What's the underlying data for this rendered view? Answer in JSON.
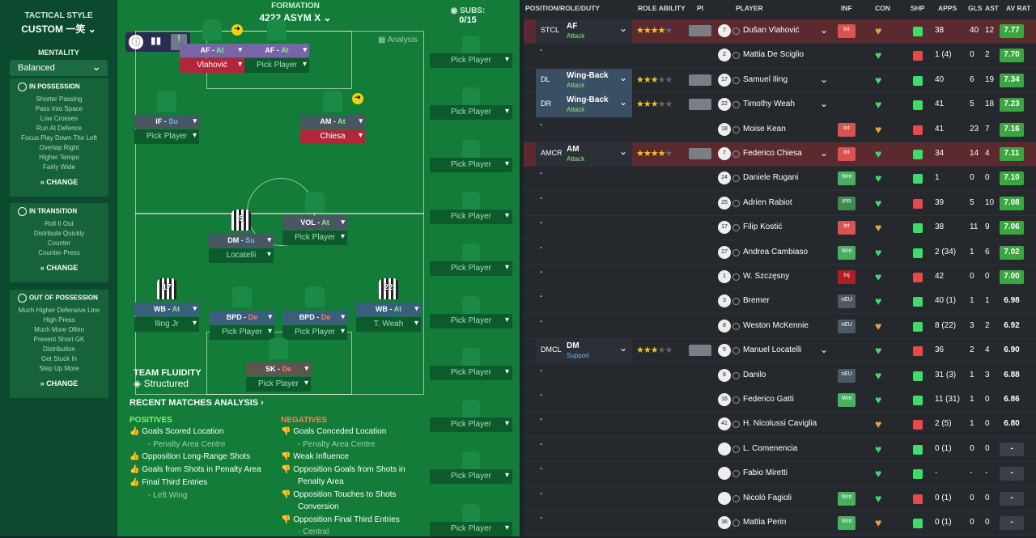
{
  "sidebar": {
    "tactical_style_label": "TACTICAL STYLE",
    "tactical_style": "CUSTOM 一笑",
    "mentality_label": "MENTALITY",
    "mentality": "Balanced",
    "in_possession": {
      "title": "IN POSSESSION",
      "items": [
        "Shorter Passing",
        "Pass Into Space",
        "Low Crosses",
        "Run At Defence",
        "Focus Play Down The Left",
        "Overlap Right",
        "Higher Tempo",
        "Fairly Wide"
      ],
      "change": "CHANGE"
    },
    "in_transition": {
      "title": "IN TRANSITION",
      "items": [
        "Roll It Out",
        "Distribute Quickly",
        "Counter",
        "Counter-Press"
      ],
      "change": "CHANGE"
    },
    "out_of_possession": {
      "title": "OUT OF POSSESSION",
      "items": [
        "Much Higher Defensive Line",
        "High Press",
        "Much More Often",
        "Prevent Short GK",
        "Distribution",
        "Get Stuck In",
        "Step Up More"
      ],
      "change": "CHANGE"
    }
  },
  "pitch": {
    "formation_label": "FORMATION",
    "formation": "4222 ASYM X",
    "analysis": "Analysis",
    "subs_label": "SUBS:",
    "subs_count": "0/15",
    "pick": "Pick Player",
    "team_fluidity_label": "TEAM FLUIDITY",
    "team_fluidity": "Structured",
    "positions": [
      {
        "role": "AF",
        "duty": "At",
        "player": "Vlahović",
        "num": ""
      },
      {
        "role": "AF",
        "duty": "At",
        "player": "Pick Player",
        "num": ""
      },
      {
        "role": "IF",
        "duty": "Su",
        "player": "Pick Player",
        "num": ""
      },
      {
        "role": "AM",
        "duty": "At",
        "player": "Chiesa",
        "num": ""
      },
      {
        "role": "VOL",
        "duty": "At",
        "player": "Pick Player",
        "num": ""
      },
      {
        "role": "DM",
        "duty": "Su",
        "player": "Locatelli",
        "num": "5"
      },
      {
        "role": "WB",
        "duty": "At",
        "player": "Iling Jr",
        "num": "17"
      },
      {
        "role": "BPD",
        "duty": "De",
        "player": "Pick Player",
        "num": ""
      },
      {
        "role": "BPD",
        "duty": "De",
        "player": "Pick Player",
        "num": ""
      },
      {
        "role": "WB",
        "duty": "At",
        "player": "T. Weah",
        "num": "22"
      },
      {
        "role": "SK",
        "duty": "De",
        "player": "Pick Player",
        "num": ""
      }
    ]
  },
  "analysis": {
    "title": "RECENT MATCHES ANALYSIS",
    "positives_label": "POSITIVES",
    "positives": [
      "Goals Scored Location",
      "- Penalty Area Centre",
      "Opposition Long-Range Shots",
      "Goals from Shots in Penalty Area",
      "Final Third Entries",
      "- Left Wing"
    ],
    "negatives_label": "NEGATIVES",
    "negatives": [
      "Goals Conceded Location",
      "- Penalty Area Centre",
      "Weak Influence",
      "Opposition Goals from Shots in",
      "Penalty Area",
      "Opposition Touches to Shots",
      "Conversion",
      "Opposition Final Third Entries",
      "- Central"
    ]
  },
  "table": {
    "headers": [
      "POSITION/ROLE/DUTY",
      "ROLE ABILITY",
      "PI",
      "PLAYER",
      "INF",
      "CON",
      "SHP",
      "APPS",
      "GLS",
      "AST",
      "AV RAT"
    ],
    "rows": [
      {
        "pos": "STCL",
        "role": "AF",
        "duty": "Attack",
        "stars": "★★★★",
        "estars": "★",
        "num": "7",
        "name": "Dušan Vlahović",
        "inf": "Int",
        "apps": "38",
        "gls": "40",
        "ast": "12",
        "rat": "7.77"
      },
      {
        "pos": "",
        "role": "",
        "duty": "",
        "stars": "",
        "estars": "",
        "num": "2",
        "name": "Mattia De Sciglio",
        "inf": "",
        "apps": "1 (4)",
        "gls": "0",
        "ast": "2",
        "rat": "7.70"
      },
      {
        "pos": "DL",
        "role": "Wing-Back",
        "duty": "Attack",
        "stars": "★★★",
        "estars": "★★",
        "num": "17",
        "name": "Samuel Iling",
        "inf": "",
        "apps": "40",
        "gls": "6",
        "ast": "19",
        "rat": "7.34"
      },
      {
        "pos": "DR",
        "role": "Wing-Back",
        "duty": "Attack",
        "stars": "★★★",
        "estars": "★★",
        "num": "22",
        "name": "Timothy Weah",
        "inf": "",
        "apps": "41",
        "gls": "5",
        "ast": "18",
        "rat": "7.23"
      },
      {
        "pos": "",
        "role": "",
        "duty": "",
        "stars": "",
        "estars": "",
        "num": "18",
        "name": "Moise Kean",
        "inf": "Int",
        "apps": "41",
        "gls": "23",
        "ast": "7",
        "rat": "7.16"
      },
      {
        "pos": "AMCR",
        "role": "AM",
        "duty": "Attack",
        "stars": "★★★★",
        "estars": "★",
        "num": "7",
        "name": "Federico Chiesa",
        "inf": "Int",
        "apps": "34",
        "gls": "14",
        "ast": "4",
        "rat": "7.11"
      },
      {
        "pos": "",
        "role": "",
        "duty": "",
        "stars": "",
        "estars": "",
        "num": "24",
        "name": "Daniele Rugani",
        "inf": "Wnt",
        "apps": "1",
        "gls": "0",
        "ast": "0",
        "rat": "7.10"
      },
      {
        "pos": "",
        "role": "",
        "duty": "",
        "stars": "",
        "estars": "",
        "num": "25",
        "name": "Adrien Rabiot",
        "inf": "IPR",
        "apps": "39",
        "gls": "5",
        "ast": "10",
        "rat": "7.08"
      },
      {
        "pos": "",
        "role": "",
        "duty": "",
        "stars": "",
        "estars": "",
        "num": "17",
        "name": "Filip Kostić",
        "inf": "Int",
        "apps": "38",
        "gls": "11",
        "ast": "9",
        "rat": "7.06"
      },
      {
        "pos": "",
        "role": "",
        "duty": "",
        "stars": "",
        "estars": "",
        "num": "27",
        "name": "Andrea Cambiaso",
        "inf": "Wnt",
        "apps": "2 (34)",
        "gls": "1",
        "ast": "6",
        "rat": "7.02"
      },
      {
        "pos": "",
        "role": "",
        "duty": "",
        "stars": "",
        "estars": "",
        "num": "1",
        "name": "W. Szczęsny",
        "inf": "Inj",
        "apps": "42",
        "gls": "0",
        "ast": "0",
        "rat": "7.00"
      },
      {
        "pos": "",
        "role": "",
        "duty": "",
        "stars": "",
        "estars": "",
        "num": "3",
        "name": "Bremer",
        "inf": "nEU",
        "apps": "40 (1)",
        "gls": "1",
        "ast": "1",
        "rat": "6.98"
      },
      {
        "pos": "",
        "role": "",
        "duty": "",
        "stars": "",
        "estars": "",
        "num": "8",
        "name": "Weston McKennie",
        "inf": "nEU",
        "apps": "8 (22)",
        "gls": "3",
        "ast": "2",
        "rat": "6.92"
      },
      {
        "pos": "DMCL",
        "role": "DM",
        "duty": "Support",
        "stars": "★★★",
        "estars": "★★",
        "num": "5",
        "name": "Manuel Locatelli",
        "inf": "",
        "apps": "36",
        "gls": "2",
        "ast": "4",
        "rat": "6.90"
      },
      {
        "pos": "",
        "role": "",
        "duty": "",
        "stars": "",
        "estars": "",
        "num": "6",
        "name": "Danilo",
        "inf": "nEU",
        "apps": "31 (3)",
        "gls": "1",
        "ast": "3",
        "rat": "6.88"
      },
      {
        "pos": "",
        "role": "",
        "duty": "",
        "stars": "",
        "estars": "",
        "num": "16",
        "name": "Federico Gatti",
        "inf": "Wnt",
        "apps": "11 (31)",
        "gls": "1",
        "ast": "0",
        "rat": "6.86"
      },
      {
        "pos": "",
        "role": "",
        "duty": "",
        "stars": "",
        "estars": "",
        "num": "41",
        "name": "H. Nicolussi Caviglia",
        "inf": "",
        "apps": "2 (5)",
        "gls": "1",
        "ast": "0",
        "rat": "6.80"
      },
      {
        "pos": "",
        "role": "",
        "duty": "",
        "stars": "",
        "estars": "",
        "num": "",
        "name": "L. Comenencia",
        "inf": "",
        "apps": "0 (1)",
        "gls": "0",
        "ast": "0",
        "rat": "-"
      },
      {
        "pos": "",
        "role": "",
        "duty": "",
        "stars": "",
        "estars": "",
        "num": "",
        "name": "Fabio Miretti",
        "inf": "",
        "apps": "-",
        "gls": "-",
        "ast": "-",
        "rat": "-"
      },
      {
        "pos": "",
        "role": "",
        "duty": "",
        "stars": "",
        "estars": "",
        "num": "",
        "name": "Nicolò Fagioli",
        "inf": "Wnt",
        "apps": "0 (1)",
        "gls": "0",
        "ast": "0",
        "rat": "-"
      },
      {
        "pos": "",
        "role": "",
        "duty": "",
        "stars": "",
        "estars": "",
        "num": "36",
        "name": "Mattia Perin",
        "inf": "Wnt",
        "apps": "0 (1)",
        "gls": "0",
        "ast": "0",
        "rat": "-"
      }
    ]
  },
  "colors": {
    "pitch": "#137c39",
    "sidebar": "#0b4a2e",
    "rating_high": "#3aa640",
    "selected_row": "#5a2a2f"
  }
}
